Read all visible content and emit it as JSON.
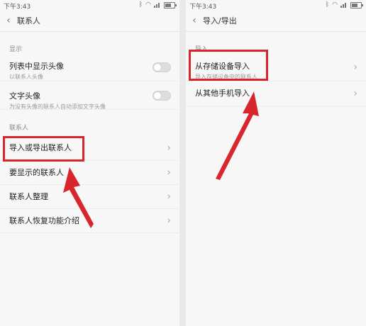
{
  "colors": {
    "annotation": "#d9262c",
    "background": "#f7f7f7"
  },
  "left": {
    "status_time": "下午3:43",
    "title": "联系人",
    "section_display": "显示",
    "row_show_avatar": {
      "title": "列表中显示头像",
      "subtitle": "以联系人头像"
    },
    "row_text_avatar": {
      "title": "文字头像",
      "subtitle": "为没有头像的联系人自动添加文字头像"
    },
    "section_contacts": "联系人",
    "row_import_export": "导入或导出联系人",
    "row_display_contacts": "要显示的联系人",
    "row_organize": "联系人整理",
    "row_restore_intro": "联系人恢复功能介绍"
  },
  "right": {
    "status_time": "下午3:43",
    "title": "导入/导出",
    "section_import": "导入",
    "row_from_storage": {
      "title": "从存储设备导入",
      "subtitle": "导入存储设备中的联系人"
    },
    "row_from_other_phone": "从其他手机导入"
  }
}
